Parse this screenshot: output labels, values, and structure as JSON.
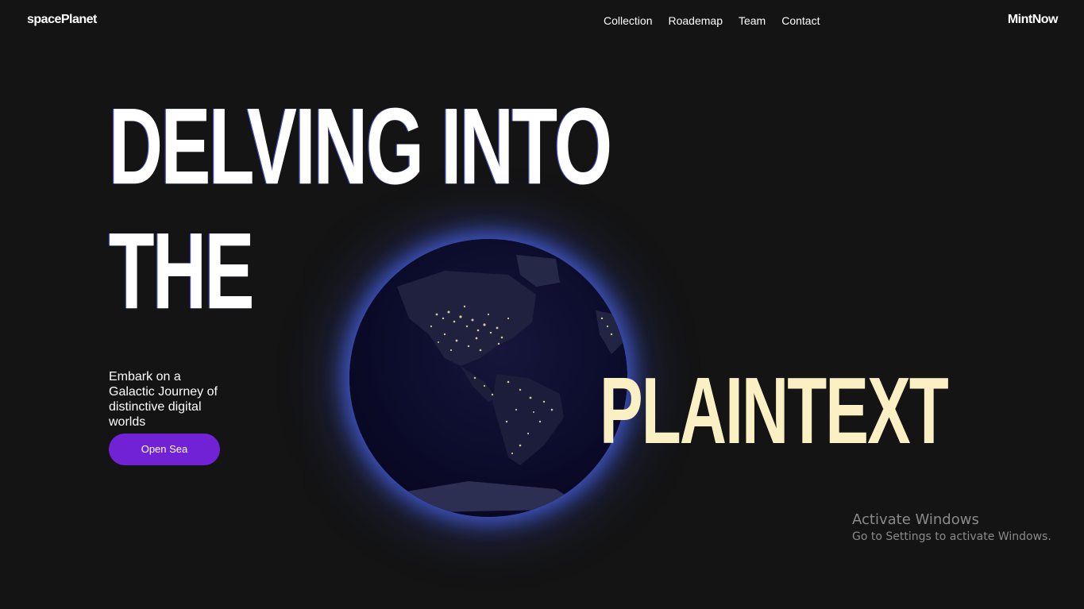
{
  "header": {
    "brand": "spacePlanet",
    "nav": [
      "Collection",
      "Roademap",
      "Team",
      "Contact"
    ],
    "cta": "MintNow"
  },
  "hero": {
    "line1": "DELVING INTO",
    "line2": "THE",
    "line3": "PLAINTEXT",
    "tagline": "Embark on a Galactic Journey of distinctive digital worlds",
    "button": "Open Sea"
  },
  "watermark": {
    "title": "Activate Windows",
    "subtitle": "Go to Settings to activate Windows."
  },
  "colors": {
    "background": "#141414",
    "accent": "#7122d4",
    "highlight": "#fbefc4",
    "glow": "#5060ff"
  }
}
